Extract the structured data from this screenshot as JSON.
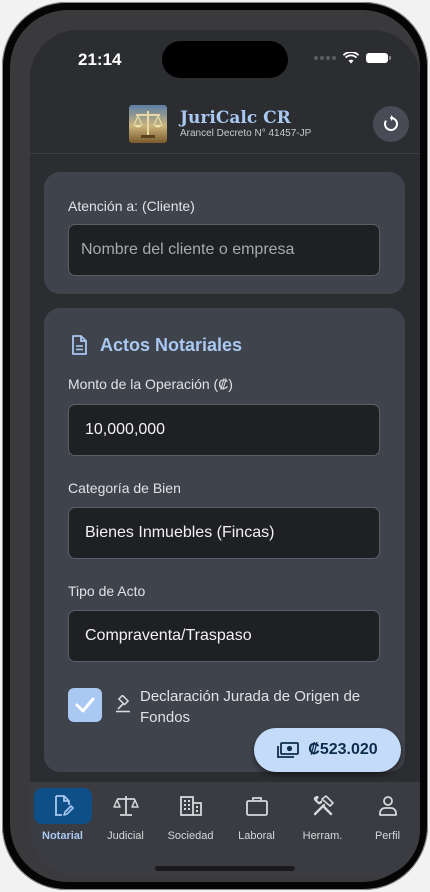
{
  "status_bar": {
    "time": "21:14"
  },
  "header": {
    "title": "JuriCalc CR",
    "subtitle": "Arancel Decreto N° 41457-JP",
    "logo_icon": "scales-of-justice-logo",
    "reset_icon": "refresh-icon"
  },
  "client_card": {
    "label": "Atención a: (Cliente)",
    "placeholder": "Nombre del cliente o empresa",
    "value": ""
  },
  "notarial_card": {
    "section_title": "Actos Notariales",
    "section_icon": "document-icon",
    "amount_label": "Monto de la Operación (₡)",
    "amount_value": "10,000,000",
    "category_label": "Categoría de Bien",
    "category_value": "Bienes Inmuebles (Fincas)",
    "act_type_label": "Tipo de Acto",
    "act_type_value": "Compraventa/Traspaso",
    "declaration_checked": true,
    "declaration_label": "Declaración Jurada de Origen de Fondos"
  },
  "total_fab": {
    "amount": "₡523.020",
    "icon": "money-icon"
  },
  "bottom_nav": {
    "items": [
      {
        "label": "Notarial",
        "icon": "document-edit-icon",
        "active": true
      },
      {
        "label": "Judicial",
        "icon": "scales-icon",
        "active": false
      },
      {
        "label": "Sociedad",
        "icon": "building-icon",
        "active": false
      },
      {
        "label": "Laboral",
        "icon": "briefcase-icon",
        "active": false
      },
      {
        "label": "Herram.",
        "icon": "tools-icon",
        "active": false
      },
      {
        "label": "Perfil",
        "icon": "person-icon",
        "active": false
      }
    ]
  },
  "colors": {
    "accent": "#a9c8f2",
    "background": "#2b2d31",
    "card": "#3f434b",
    "fab": "#c4dcfa",
    "nav_active": "#0d4f86"
  }
}
